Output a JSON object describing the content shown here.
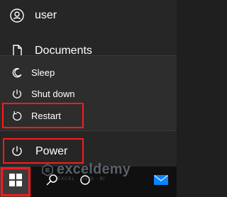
{
  "start_menu": {
    "items": {
      "user": {
        "label": "user",
        "icon": "user-icon"
      },
      "documents": {
        "label": "Documents",
        "icon": "document-icon"
      }
    },
    "power_flyout": {
      "sleep": {
        "label": "Sleep",
        "icon": "sleep-icon"
      },
      "shutdown": {
        "label": "Shut down",
        "icon": "power-icon"
      },
      "restart": {
        "label": "Restart",
        "icon": "restart-icon"
      }
    },
    "power": {
      "label": "Power",
      "icon": "power-icon"
    }
  },
  "taskbar": {
    "start_icon": "windows-start-icon",
    "search_icon": "search-icon",
    "task_view_icon": "task-view-icon",
    "mail_icon": "mail-icon"
  },
  "watermark": {
    "title": "exceldemy",
    "subtitle": "EXCEL · DATA · BI",
    "logo_icon": "exceldemy-logo-icon"
  },
  "colors": {
    "menu_background": "#262626",
    "flyout_background": "#2d2d2d",
    "taskbar_background": "#101010",
    "highlight": "#ff1a1a",
    "mail_blue": "#0a84ff"
  }
}
